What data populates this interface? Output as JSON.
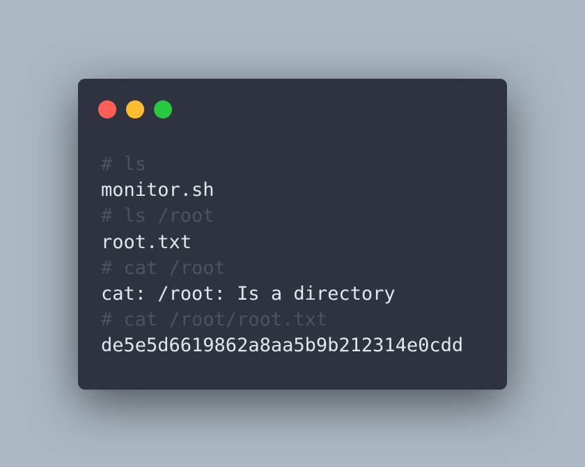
{
  "window": {
    "background_color": "#2e333f",
    "controls": [
      {
        "name": "close",
        "color": "#ff5f57",
        "icon": "close-dot-icon"
      },
      {
        "name": "minimize",
        "color": "#febc2e",
        "icon": "minimize-dot-icon"
      },
      {
        "name": "maximize",
        "color": "#28c840",
        "icon": "maximize-dot-icon"
      }
    ]
  },
  "colors": {
    "comment": "#4b5363",
    "output": "#e3e6ec"
  },
  "terminal": {
    "lines": [
      {
        "type": "comment",
        "text": "# ls"
      },
      {
        "type": "output",
        "text": "monitor.sh"
      },
      {
        "type": "comment",
        "text": "# ls /root"
      },
      {
        "type": "output",
        "text": "root.txt"
      },
      {
        "type": "comment",
        "text": "# cat /root"
      },
      {
        "type": "output",
        "text": "cat: /root: Is a directory"
      },
      {
        "type": "comment",
        "text": "# cat /root/root.txt"
      },
      {
        "type": "output",
        "text": "de5e5d6619862a8aa5b9b212314e0cdd"
      }
    ]
  }
}
